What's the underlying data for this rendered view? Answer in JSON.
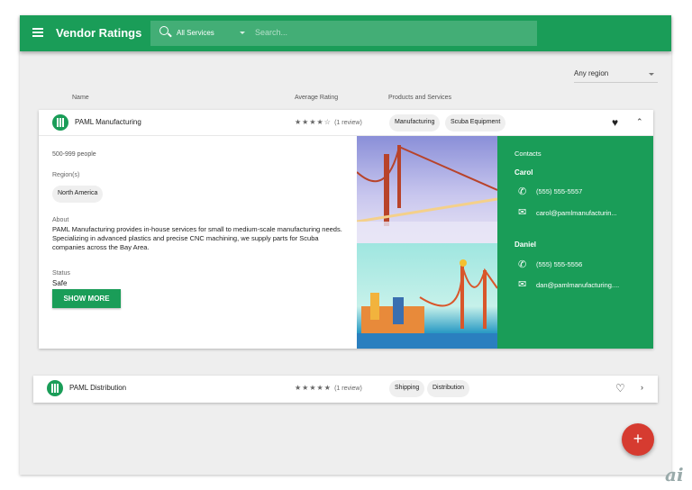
{
  "app": {
    "title": "Vendor Ratings",
    "service_filter": "All Services",
    "search_placeholder": "Search...",
    "region_filter": "Any region"
  },
  "columns": {
    "name": "Name",
    "rating": "Average Rating",
    "products": "Products and Services"
  },
  "vendors": [
    {
      "name": "PAML Manufacturing",
      "stars": "★★★★☆",
      "rating": 4,
      "reviews": "(1 review)",
      "tags": [
        "Manufacturing",
        "Scuba Equipment"
      ],
      "favorite": true,
      "expanded": true,
      "size": "500-999 people",
      "regions_label": "Region(s)",
      "region": "North America",
      "about_label": "About",
      "about": "PAML Manufacturing provides in-house services for small to medium-scale manufacturing needs. Specializing in advanced plastics and precise CNC machining, we supply parts for Scuba companies across the Bay Area.",
      "status_label": "Status",
      "status": "Safe",
      "show_more": "SHOW MORE",
      "contacts_label": "Contacts",
      "contacts": [
        {
          "name": "Carol",
          "phone": "(555) 555-5557",
          "email": "carol@pamlmanufacturin..."
        },
        {
          "name": "Daniel",
          "phone": "(555) 555-5556",
          "email": "dan@pamlmanufacturing...."
        }
      ]
    },
    {
      "name": "PAML Distribution",
      "stars": "★★★★★",
      "rating": 5,
      "reviews": "(1 review)",
      "tags": [
        "Shipping",
        "Distribution"
      ],
      "favorite": false,
      "expanded": false
    }
  ],
  "fab": "+",
  "watermark": "ai",
  "colors": {
    "primary": "#1a9d58",
    "fab": "#d63b30"
  }
}
